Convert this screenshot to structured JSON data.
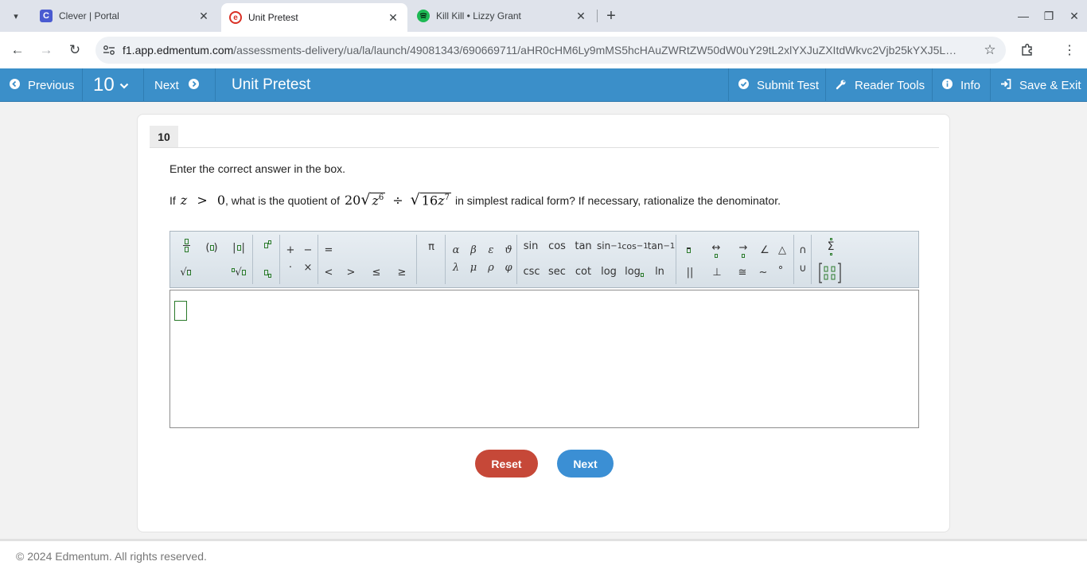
{
  "browser": {
    "tabs": [
      {
        "title": "Clever | Portal",
        "favicon": "C",
        "favicon_color": "#4a5bd1"
      },
      {
        "title": "Unit Pretest",
        "favicon": "e",
        "favicon_color": "#d93025",
        "active": true
      },
      {
        "title": "Kill Kill • Lizzy Grant",
        "favicon": "spotify",
        "favicon_color": "#1db954"
      }
    ],
    "url_host": "f1.app.edmentum.com",
    "url_path": "/assessments-delivery/ua/la/launch/49081343/690669711/aHR0cHM6Ly9mMS5hcHAuZWRtZW50dW0uY29tL2xlYXJuZXItdWkvc2Vjb25kYXJ5L…"
  },
  "header": {
    "previous_label": "Previous",
    "question_number": "10",
    "next_label": "Next",
    "title": "Unit Pretest",
    "submit_label": "Submit Test",
    "reader_tools_label": "Reader Tools",
    "info_label": "Info",
    "save_exit_label": "Save & Exit",
    "accent_color": "#3b8fc9"
  },
  "question": {
    "number": "10",
    "instruction": "Enter the correct answer in the box.",
    "prefix": "If",
    "var": "z",
    "gt": ">",
    "zero": "0",
    "mid_text": ", what is the quotient of",
    "coef1": "20",
    "rad1_base": "z",
    "rad1_exp": "6",
    "div_sign": "÷",
    "rad2_coef": "16",
    "rad2_base": "z",
    "rad2_exp": "7",
    "suffix": "in simplest radical form? If necessary, rationalize the denominator."
  },
  "palette": {
    "trig_top": [
      "sin",
      "cos",
      "tan",
      "sin",
      "cos",
      "tan"
    ],
    "trig_bottom": [
      "csc",
      "sec",
      "cot",
      "log",
      "log",
      "ln"
    ],
    "inverse_exp": "−1",
    "greek_top": [
      "α",
      "β",
      "ε",
      "ϑ"
    ],
    "greek_bottom": [
      "λ",
      "μ",
      "ρ",
      "φ"
    ],
    "ops_top": [
      "+",
      "−"
    ],
    "ops_bottom": [
      "·",
      "×"
    ],
    "relations_top": [
      "="
    ],
    "relations_bottom": [
      "<",
      ">",
      "≤",
      "≥"
    ],
    "pi": "π",
    "geometry_top": [
      "↔",
      "→",
      "∠",
      "△"
    ],
    "geometry_bottom": [
      "||",
      "⊥",
      "≅",
      "~",
      "°"
    ],
    "sets_top": "∩",
    "sets_bottom": "∪",
    "sum": "Σ"
  },
  "buttons": {
    "reset_label": "Reset",
    "next_label": "Next"
  },
  "footer": {
    "copyright": "© 2024 Edmentum. All rights reserved."
  }
}
